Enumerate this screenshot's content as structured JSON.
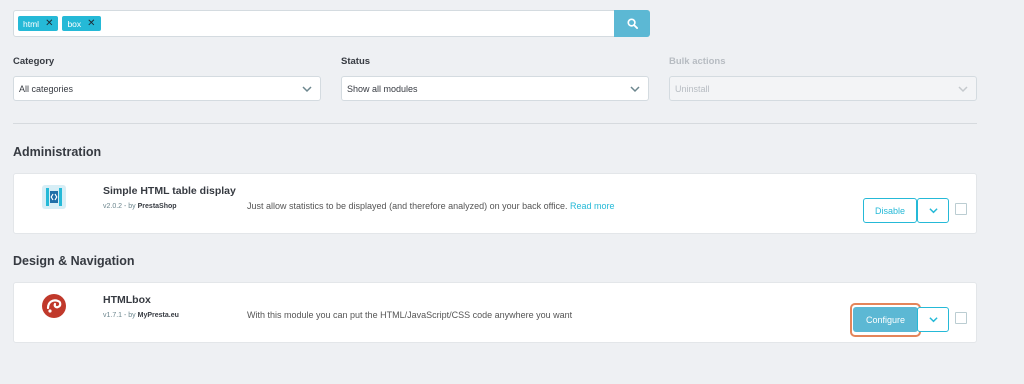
{
  "search": {
    "tags": [
      {
        "label": "html"
      },
      {
        "label": "box"
      }
    ],
    "remove_glyph": "✕",
    "button_icon": "search-icon",
    "accent_color": "#5cb8d4"
  },
  "filters": {
    "category": {
      "label": "Category",
      "value": "All categories"
    },
    "status": {
      "label": "Status",
      "value": "Show all modules"
    },
    "bulk": {
      "label": "Bulk actions",
      "value": "Uninstall",
      "disabled": true
    }
  },
  "sections": [
    {
      "title": "Administration",
      "module": {
        "name": "Simple HTML table display",
        "version": "v2.0.2 - by",
        "author": "PrestaShop",
        "description": "Just allow statistics to be displayed (and therefore analyzed) on your back office.",
        "read_more": "Read more",
        "action": "Disable"
      }
    },
    {
      "title": "Design & Navigation",
      "module": {
        "name": "HTMLbox",
        "version": "v1.7.1 - by",
        "author": "MyPresta.eu",
        "description": "With this module you can put the HTML/JavaScript/CSS code anywhere you want",
        "action": "Configure"
      }
    }
  ],
  "colors": {
    "primary": "#25b9d7",
    "highlight": "#e4855a"
  }
}
